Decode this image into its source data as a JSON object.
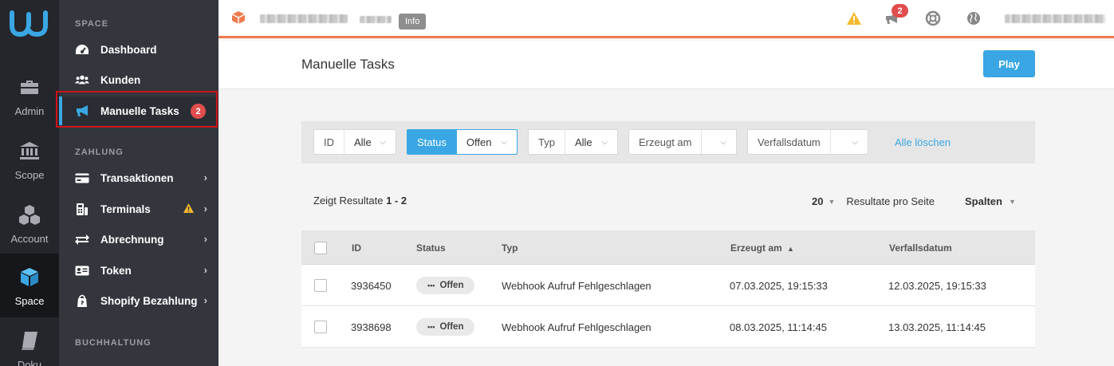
{
  "rail": {
    "items": [
      {
        "label": "Admin",
        "icon": "briefcase-icon"
      },
      {
        "label": "Scope",
        "icon": "bank-icon"
      },
      {
        "label": "Account",
        "icon": "cubes-icon"
      },
      {
        "label": "Space",
        "icon": "cube-icon"
      },
      {
        "label": "Doku",
        "icon": "book-icon"
      }
    ],
    "active": "Space"
  },
  "sidenav": {
    "sections": {
      "space": "SPACE",
      "zahlung": "ZAHLUNG",
      "buchhaltung": "BUCHHALTUNG"
    },
    "items": {
      "dashboard": "Dashboard",
      "kunden": "Kunden",
      "manuelle_tasks": "Manuelle Tasks",
      "manuelle_tasks_count": "2",
      "transaktionen": "Transaktionen",
      "terminals": "Terminals",
      "abrechnung": "Abrechnung",
      "token": "Token",
      "shopify": "Shopify Bezahlung"
    }
  },
  "header": {
    "info_badge": "Info",
    "notification_count": "2"
  },
  "page": {
    "title": "Manuelle Tasks",
    "play_label": "Play"
  },
  "filters": [
    {
      "label": "ID",
      "value": "Alle"
    },
    {
      "label": "Status",
      "value": "Offen"
    },
    {
      "label": "Typ",
      "value": "Alle"
    },
    {
      "label": "Erzeugt am",
      "value": ""
    },
    {
      "label": "Verfallsdatum",
      "value": ""
    }
  ],
  "clear_filters": "Alle löschen",
  "results": {
    "prefix": "Zeigt Resultate",
    "range": "1 - 2",
    "per_page": "20",
    "per_page_label": "Resultate pro Seite",
    "columns_label": "Spalten"
  },
  "table": {
    "headers": {
      "id": "ID",
      "status": "Status",
      "typ": "Typ",
      "erzeugt": "Erzeugt am",
      "verfall": "Verfallsdatum"
    },
    "sort": {
      "column": "Erzeugt am",
      "direction": "ascending"
    },
    "rows": [
      {
        "id": "3936450",
        "status": "Offen",
        "typ": "Webhook Aufruf Fehlgeschlagen",
        "erzeugt": "07.03.2025, 19:15:33",
        "verfall": "12.03.2025, 19:15:33"
      },
      {
        "id": "3938698",
        "status": "Offen",
        "typ": "Webhook Aufruf Fehlgeschlagen",
        "erzeugt": "08.03.2025, 11:14:45",
        "verfall": "13.03.2025, 11:14:45"
      }
    ]
  },
  "colors": {
    "accent": "#3aa7e4",
    "header_line": "#ef7b4e",
    "badge": "#e14d4d",
    "warning": "#f5b82e"
  }
}
